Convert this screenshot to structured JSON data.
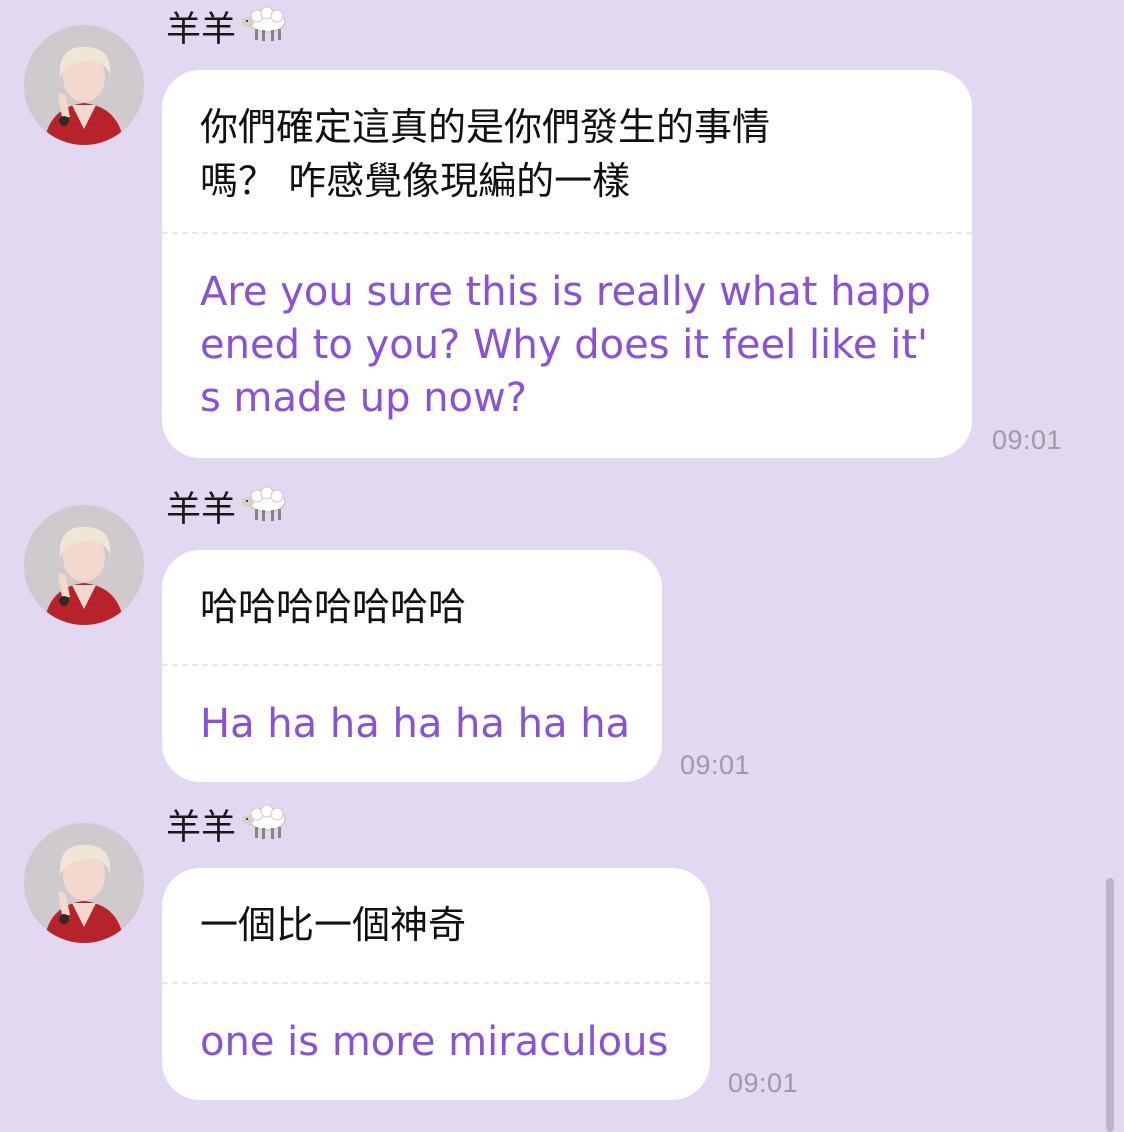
{
  "messages": [
    {
      "sender": "羊羊",
      "sender_icon": "sheep-icon",
      "original": "你們確定這真的是你們發生的事情\n嗎？ 咋感覺像現編的一樣",
      "translation": "Are you sure this is really what happ\nened to you? Why does it feel like it'\ns made up now?",
      "time": "09:01"
    },
    {
      "sender": "羊羊",
      "sender_icon": "sheep-icon",
      "original": "哈哈哈哈哈哈哈",
      "translation": "Ha ha ha ha ha ha ha",
      "time": "09:01"
    },
    {
      "sender": "羊羊",
      "sender_icon": "sheep-icon",
      "original": "一個比一個神奇",
      "translation": "one is more miraculous",
      "time": "09:01"
    }
  ],
  "colors": {
    "background": "#e3d8f1",
    "bubble": "#ffffff",
    "translation_text": "#8a50dc",
    "timestamp": "#a09aa5"
  }
}
